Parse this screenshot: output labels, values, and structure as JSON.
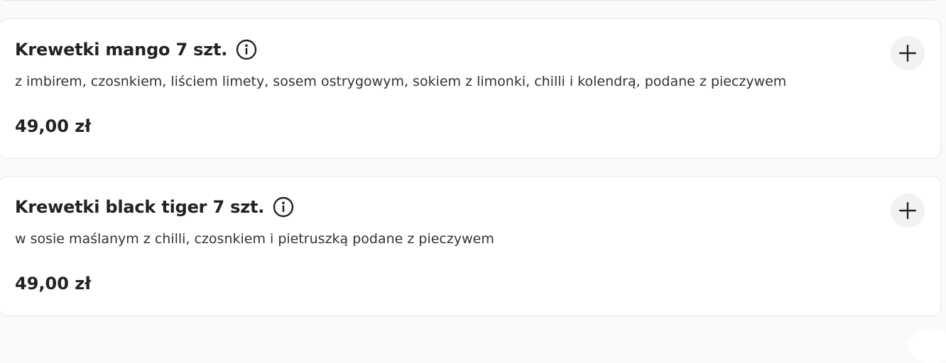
{
  "menu_items": [
    {
      "name": "Krewetki mango 7 szt.",
      "description": "z imbirem, czosnkiem, liściem limety, sosem ostrygowym, sokiem z limonki, chilli i kolendrą, podane z pieczywem",
      "price": "49,00 zł"
    },
    {
      "name": "Krewetki black tiger 7 szt.",
      "description": "w sosie maślanym z chilli, czosnkiem i pietruszką podane z pieczywem",
      "price": "49,00 zł"
    }
  ],
  "icons": {
    "info": "info-icon",
    "add": "plus-icon"
  },
  "colors": {
    "page_background": "#fafafa",
    "card_background": "#ffffff",
    "card_border": "#e6e6e6",
    "add_button_background": "#f2f2f2",
    "text": "#222222"
  }
}
